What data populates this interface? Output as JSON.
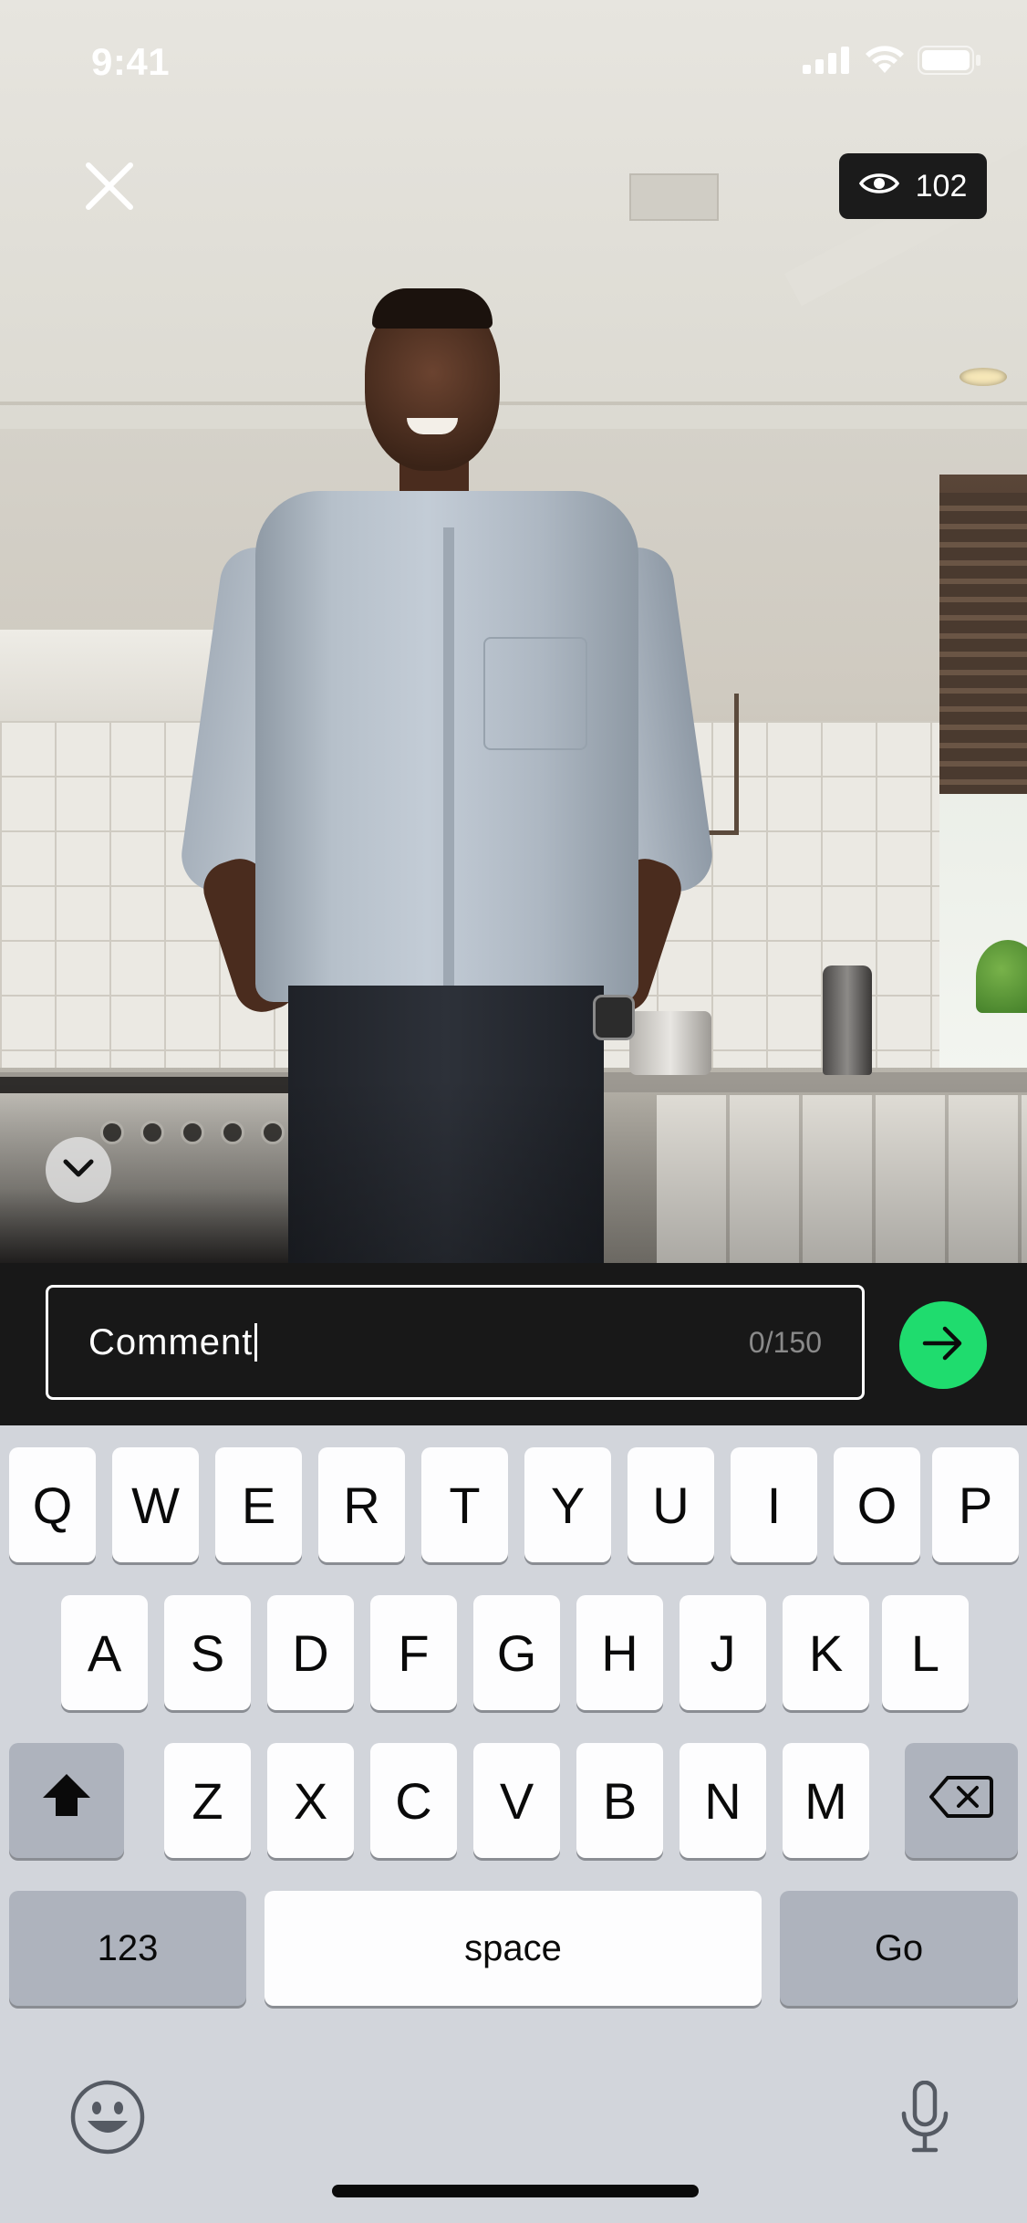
{
  "status_bar": {
    "time": "9:41",
    "icons": [
      "signal-icon",
      "wifi-icon",
      "battery-icon"
    ]
  },
  "top": {
    "close_icon": "close-icon",
    "viewer_icon": "eye-icon",
    "viewer_count": "102"
  },
  "comment": {
    "value": "Comment",
    "counter": "0/150",
    "send_icon": "arrow-right-icon"
  },
  "colors": {
    "accent": "#1fdc6e",
    "comment_bar_bg": "#181818",
    "keyboard_bg": "#d2d5db"
  },
  "keyboard": {
    "row1": [
      "Q",
      "W",
      "E",
      "R",
      "T",
      "Y",
      "U",
      "I",
      "O",
      "P"
    ],
    "row2": [
      "A",
      "S",
      "D",
      "F",
      "G",
      "H",
      "J",
      "K",
      "L"
    ],
    "row3": [
      "Z",
      "X",
      "C",
      "V",
      "B",
      "N",
      "M"
    ],
    "numbers_label": "123",
    "space_label": "space",
    "go_label": "Go",
    "shift_icon": "shift-icon",
    "delete_icon": "delete-icon",
    "emoji_icon": "emoji-icon",
    "mic_icon": "microphone-icon"
  }
}
